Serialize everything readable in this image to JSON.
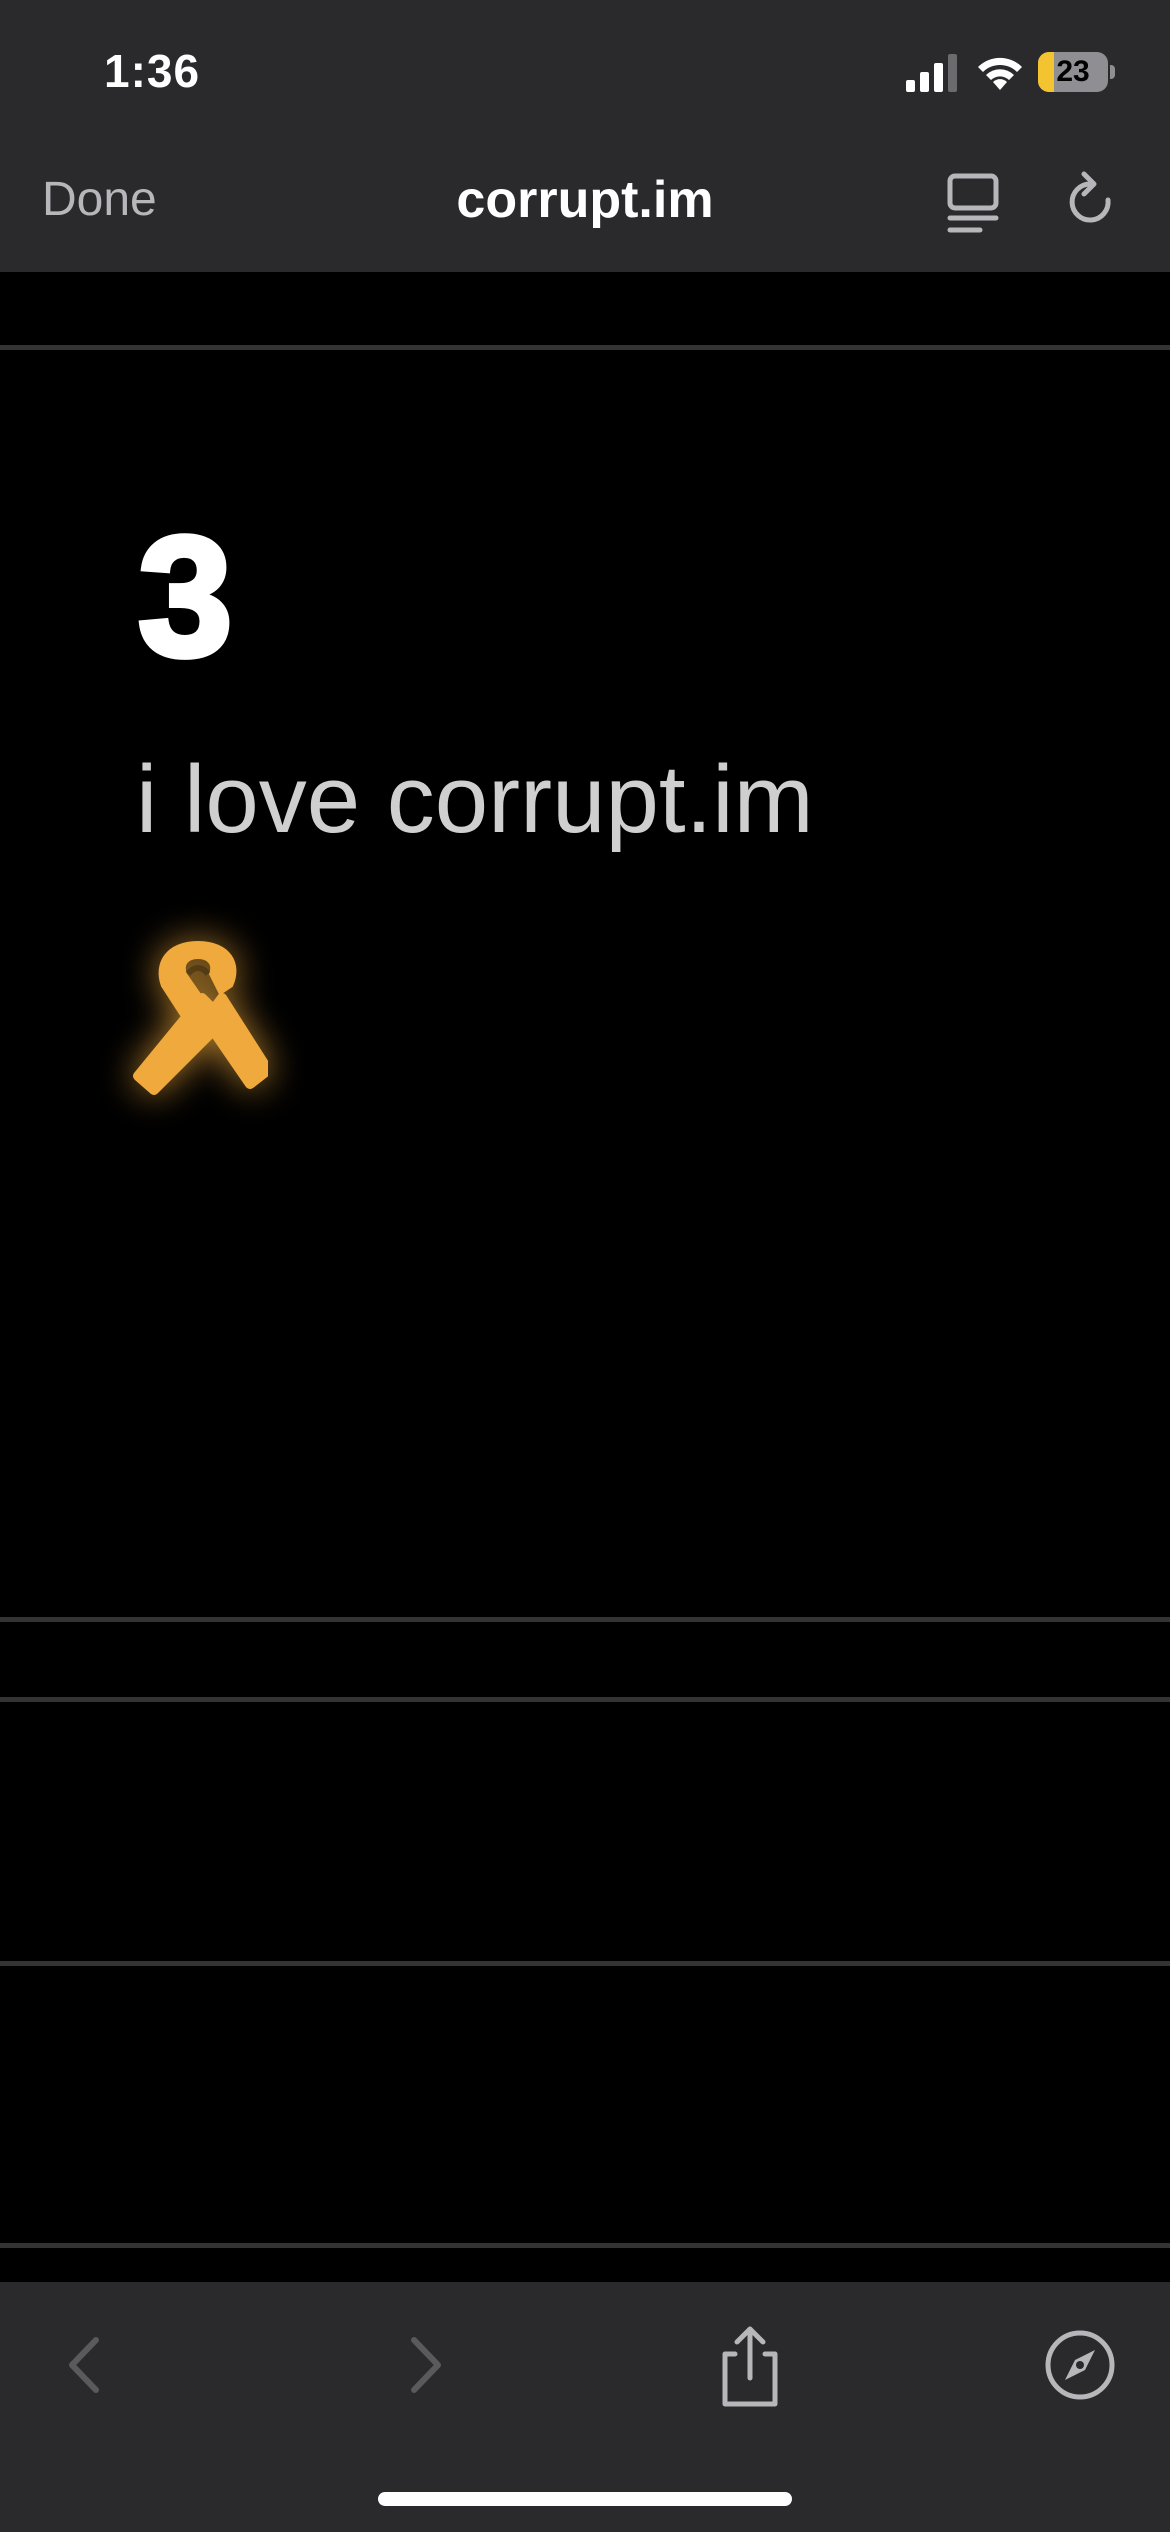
{
  "status_bar": {
    "time": "1:36",
    "battery_level": "23",
    "battery_fraction": 0.23,
    "battery_color": "#f4c430"
  },
  "nav": {
    "done_label": "Done",
    "title": "corrupt.im",
    "icons": [
      "reader-view-icon",
      "reload-icon"
    ]
  },
  "content": {
    "count": "3",
    "message": "i love corrupt.im",
    "ribbon_color": "#f0a93c"
  },
  "toolbar": {
    "icons": [
      "back-icon",
      "forward-icon",
      "share-icon",
      "compass-icon"
    ],
    "back_enabled": false,
    "forward_enabled": false
  }
}
